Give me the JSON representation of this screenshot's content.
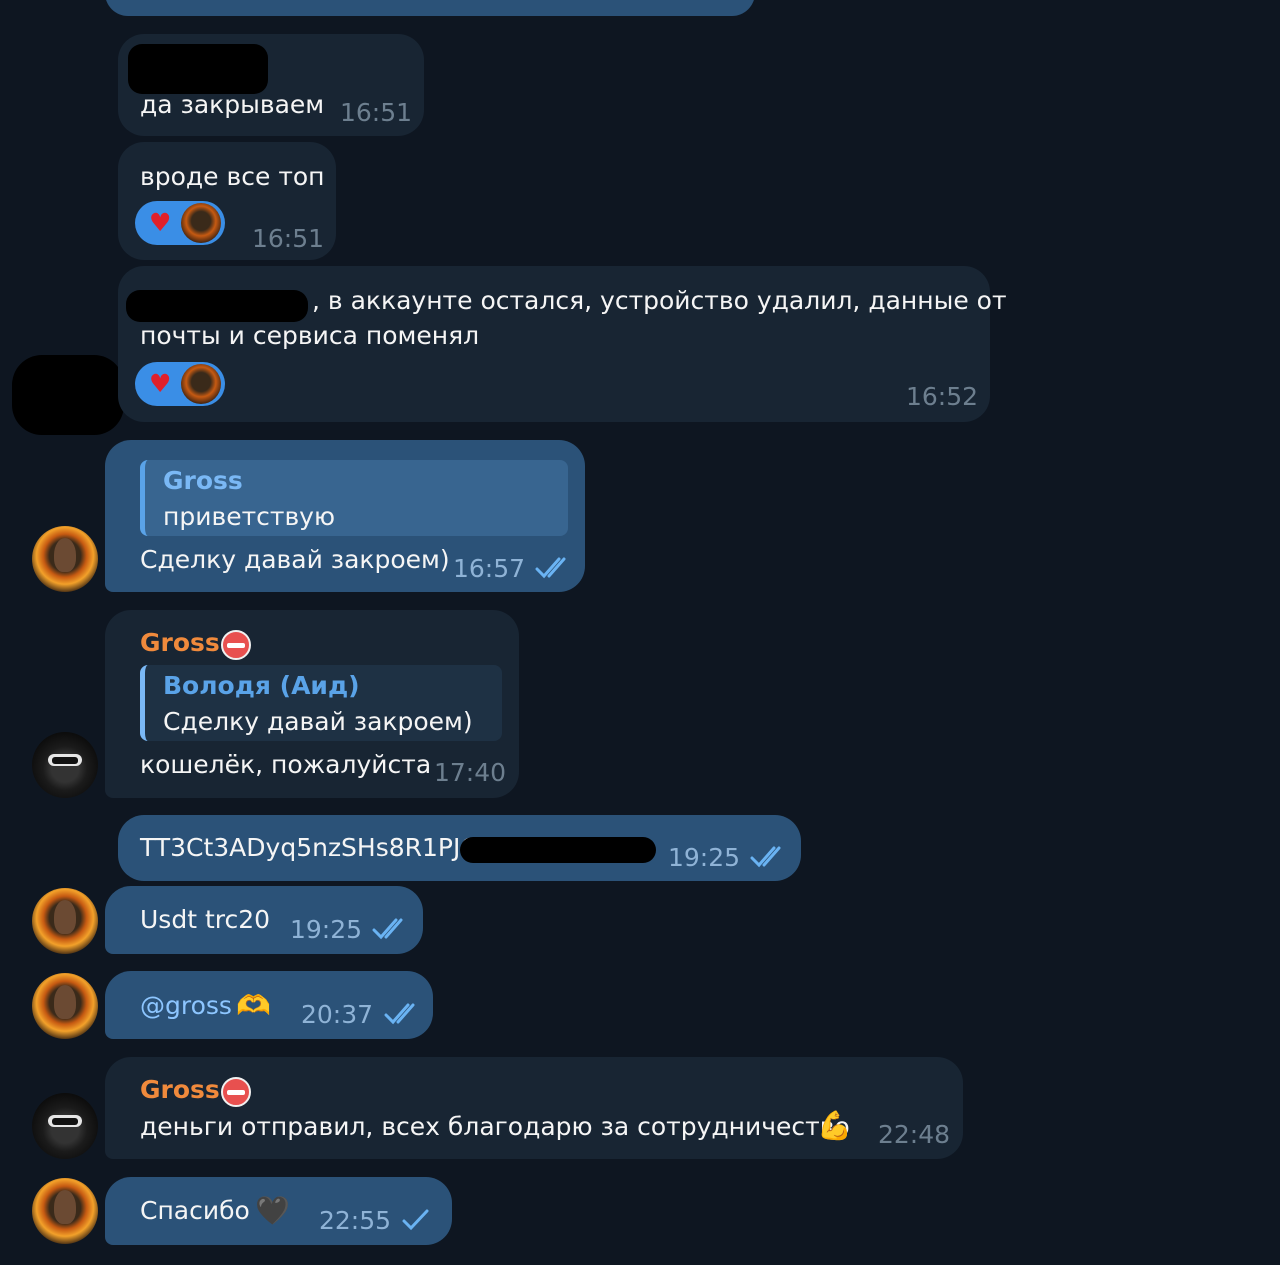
{
  "messages": {
    "m1": {
      "text": "да закрываем",
      "time": "16:51"
    },
    "m2": {
      "text": "вроде все топ",
      "time": "16:51",
      "reaction": "heart"
    },
    "m3": {
      "line1": ", в аккаунте остался, устройство удалил, данные от",
      "line2": "почты и сервиса поменял",
      "time": "16:52",
      "reaction": "heart"
    },
    "m4": {
      "reply_name": "Gross",
      "reply_text": "приветствую",
      "text": "Сделку давай закроем)",
      "time": "16:57"
    },
    "m5": {
      "sender": "Gross",
      "reply_name": "Володя (Аид)",
      "reply_text": "Сделку давай закроем)",
      "text": "кошелёк, пожалуйста",
      "time": "17:40"
    },
    "m6": {
      "text": "TT3Ct3ADyq5nzSHs8R1PJC",
      "time": "19:25"
    },
    "m7": {
      "text": "Usdt trc20",
      "time": "19:25"
    },
    "m8": {
      "text": "@gross",
      "emoji": "🫶",
      "time": "20:37"
    },
    "m9": {
      "sender": "Gross",
      "text": "деньги отправил, всех благодарю за сотрудничество",
      "emoji": "💪",
      "time": "22:48"
    },
    "m10": {
      "text": "Спасибо",
      "emoji": "🖤",
      "time": "22:55"
    }
  },
  "colors": {
    "background": "#0e1621",
    "incoming_bubble": "#182533",
    "outgoing_bubble": "#2b5278",
    "sender_name": "#f08a3c",
    "link": "#7ab8f5",
    "reaction": "#3a8ee6"
  },
  "icons": {
    "read_checks": "double-check-icon",
    "sent_check": "single-check-icon",
    "heart": "heart-icon"
  }
}
